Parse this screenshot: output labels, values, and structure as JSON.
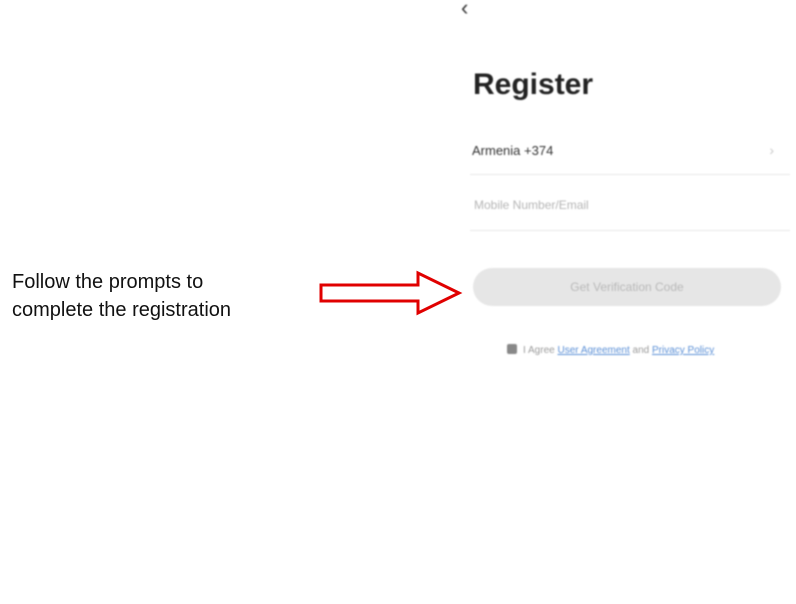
{
  "caption": {
    "line1": "Follow the prompts to",
    "line2": "complete the registration"
  },
  "arrow": {
    "color": "#e00000",
    "icon": "right-arrow-outline"
  },
  "screen": {
    "back_icon": "‹",
    "title": "Register",
    "country": {
      "label": "Armenia +374",
      "chevron": "›"
    },
    "contact_input": {
      "value": "",
      "placeholder": "Mobile Number/Email"
    },
    "code_button": {
      "label": "Get Verification Code"
    },
    "agreement": {
      "prefix": "I Agree",
      "user_agreement": "User Agreement",
      "and": "and",
      "privacy_policy": "Privacy Policy"
    },
    "colors": {
      "button_bg": "#e6e6e6",
      "link": "#5a8fd6"
    }
  }
}
